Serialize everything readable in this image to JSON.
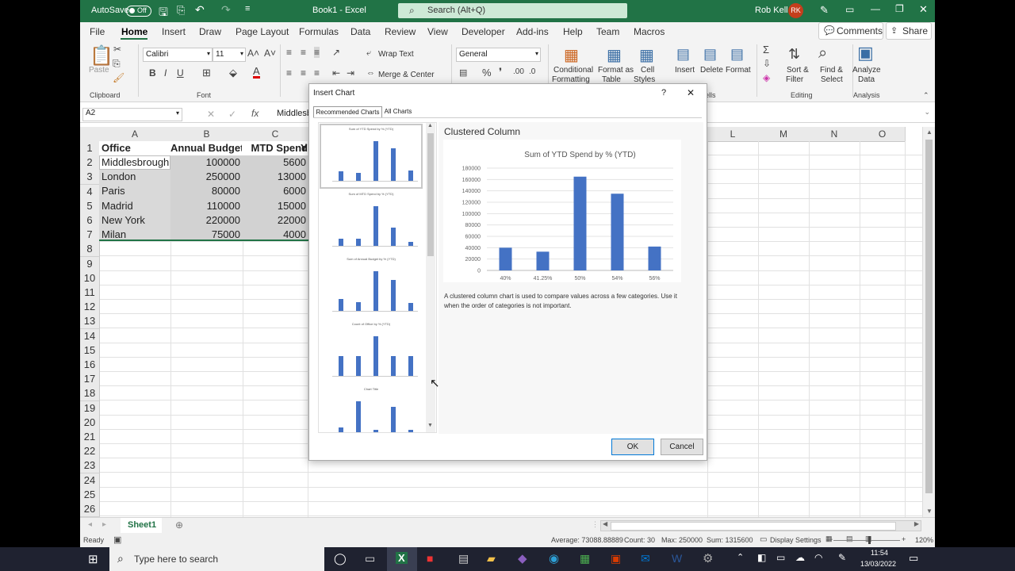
{
  "app": {
    "autosave_label": "AutoSave",
    "autosave_state": "Off",
    "doc_title": "Book1 - Excel",
    "search_placeholder": "Search (Alt+Q)",
    "user_name": "Rob Kell",
    "user_initials": "RK",
    "accent": "#217346"
  },
  "menu": [
    "File",
    "Home",
    "Insert",
    "Draw",
    "Page Layout",
    "Formulas",
    "Data",
    "Review",
    "View",
    "Developer",
    "Add-ins",
    "Help",
    "Team",
    "Macros"
  ],
  "menu_right": {
    "comments": "Comments",
    "share": "Share"
  },
  "ribbon": {
    "paste": "Paste",
    "clipboard": "Clipboard",
    "font_name": "Calibri",
    "font_size": "11",
    "font_group": "Font",
    "wrap_text": "Wrap Text",
    "merge_center": "Merge & Center",
    "number_format": "General",
    "conditional_1": "Conditional",
    "conditional_2": "Formatting",
    "format_as_1": "Format as",
    "format_as_2": "Table",
    "cell_styles_1": "Cell",
    "cell_styles_2": "Styles",
    "insert": "Insert",
    "delete": "Delete",
    "format": "Format",
    "cells_group": "ells",
    "sort_1": "Sort &",
    "sort_2": "Filter",
    "find_1": "Find &",
    "find_2": "Select",
    "editing_group": "Editing",
    "analyze_1": "Analyze",
    "analyze_2": "Data",
    "analysis_group": "Analysis"
  },
  "formula_bar": {
    "name_box": "A2",
    "fx": "fx",
    "content": "Middlesb"
  },
  "columns": [
    "A",
    "B",
    "C",
    "L",
    "M",
    "N",
    "O"
  ],
  "rows": [
    "1",
    "2",
    "3",
    "4",
    "5",
    "6",
    "7",
    "8",
    "9",
    "10",
    "11",
    "12",
    "13",
    "14",
    "15",
    "16",
    "17",
    "18",
    "19",
    "20",
    "21",
    "22",
    "23",
    "24",
    "25",
    "26"
  ],
  "table": {
    "headers": [
      "Office",
      "Annual Budget",
      "MTD Spend",
      "Y"
    ],
    "data": [
      [
        "Middlesbrough",
        "100000",
        "5600"
      ],
      [
        "London",
        "250000",
        "13000"
      ],
      [
        "Paris",
        "80000",
        "6000"
      ],
      [
        "Madrid",
        "110000",
        "15000"
      ],
      [
        "New York",
        "220000",
        "22000"
      ],
      [
        "Milan",
        "75000",
        "4000"
      ]
    ]
  },
  "sheet_tab": "Sheet1",
  "status": {
    "ready": "Ready",
    "average": "Average: 73088.88889",
    "count": "Count: 30",
    "max": "Max: 250000",
    "sum": "Sum: 1315600",
    "display_settings": "Display Settings",
    "zoom": "120%"
  },
  "dialog": {
    "title": "Insert Chart",
    "help": "?",
    "close": "✕",
    "tab_recommended": "Recommended Charts",
    "tab_all": "All Charts",
    "chart_type_name": "Clustered Column",
    "description": "A clustered column chart is used to compare values across a few categories. Use it when the order of categories is not important.",
    "ok": "OK",
    "cancel": "Cancel",
    "thumbnails": [
      {
        "title": "Sum of YTD Spend by % (YTD)",
        "values": [
          40,
          33,
          165,
          135,
          42
        ]
      },
      {
        "title": "Sum of MTD Spend by % (YTD)",
        "values": [
          18,
          18,
          100,
          45,
          10
        ]
      },
      {
        "title": "Sum of Annual Budget by % (YTD)",
        "values": [
          30,
          22,
          100,
          78,
          20
        ]
      },
      {
        "title": "Count of Office by % (YTD)",
        "values": [
          1,
          1,
          2,
          1,
          1
        ]
      },
      {
        "title": "Chart Title",
        "values": [
          12,
          35,
          10,
          30,
          10
        ]
      }
    ]
  },
  "chart_data": {
    "type": "bar",
    "title": "Sum of YTD Spend by % (YTD)",
    "categories": [
      "40%",
      "41.25%",
      "50%",
      "54%",
      "56%"
    ],
    "values": [
      40000,
      33000,
      165000,
      135000,
      42000
    ],
    "ylim": [
      0,
      180000
    ],
    "yticks": [
      "180000",
      "160000",
      "140000",
      "120000",
      "100000",
      "80000",
      "60000",
      "40000",
      "20000",
      "0"
    ],
    "color": "#4472c4",
    "grid": true
  },
  "taskbar": {
    "search_placeholder": "Type here to search",
    "time": "11:54",
    "date": "13/03/2022"
  }
}
